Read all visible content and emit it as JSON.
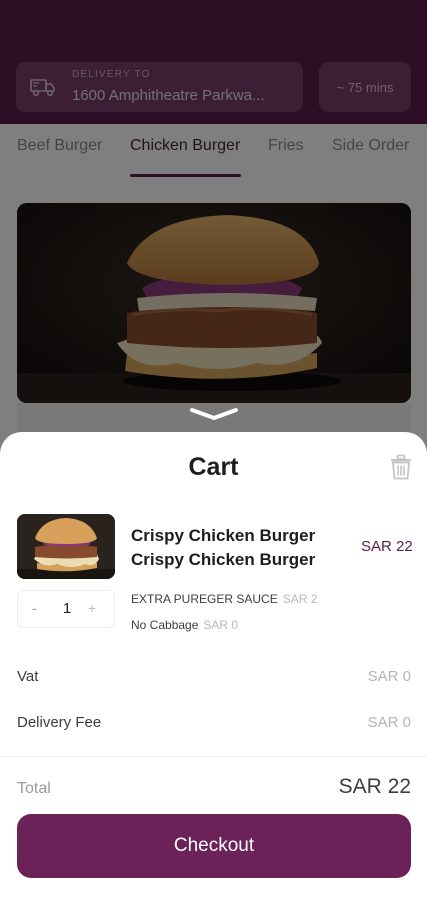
{
  "header": {
    "delivery_label": "DELIVERY TO",
    "delivery_address": "1600 Amphitheatre Parkwa...",
    "eta": "~ 75 mins"
  },
  "tabs": [
    {
      "label": "Beef Burger"
    },
    {
      "label": "Chicken Burger"
    },
    {
      "label": "Fries"
    },
    {
      "label": "Side Order"
    }
  ],
  "cart": {
    "title": "Cart",
    "item": {
      "name": "Crispy Chicken Burger Crispy Chicken Burger",
      "price": "SAR 22",
      "quantity": "1",
      "minus": "-",
      "plus": "+",
      "addons": [
        {
          "name": "EXTRA PUREGER SAUCE",
          "price": "SAR 2"
        },
        {
          "name": "No Cabbage",
          "price": "SAR 0"
        }
      ]
    },
    "vat": {
      "label": "Vat",
      "value": "SAR 0"
    },
    "delivery_fee": {
      "label": "Delivery Fee",
      "value": "SAR 0"
    },
    "total": {
      "label": "Total",
      "value": "SAR 22"
    },
    "checkout_label": "Checkout"
  },
  "colors": {
    "brand": "#6b2258",
    "header": "#5a1d4a"
  },
  "icons": [
    "truck-icon",
    "trash-icon",
    "chevron-down-icon"
  ]
}
